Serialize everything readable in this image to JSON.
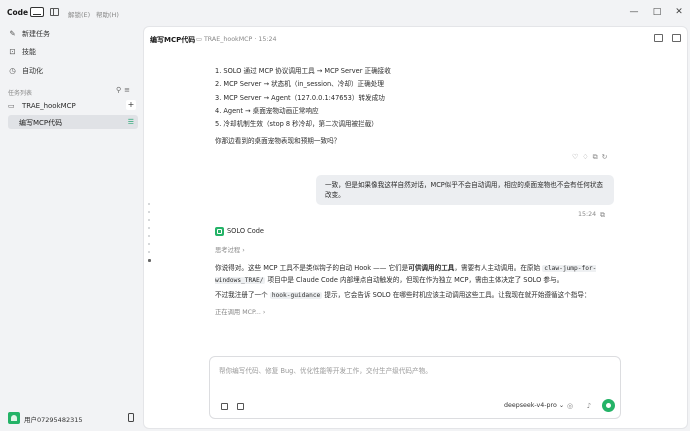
{
  "titlebar": {
    "mode": "Code",
    "menus": [
      "解锁(E)",
      "帮助(H)"
    ],
    "controls": [
      "—",
      "□",
      "✕"
    ]
  },
  "sidebar": {
    "nav": [
      {
        "label": "新建任务",
        "icon": "edit-icon"
      },
      {
        "label": "技能",
        "icon": "skills-icon"
      },
      {
        "label": "自动化",
        "icon": "clock-icon"
      }
    ],
    "section_label": "任务列表",
    "project": "TRAE_hookMCP",
    "task": "编写MCP代码",
    "user": "用户07295482315"
  },
  "header": {
    "title": "编写MCP代码",
    "path": "TRAE_hookMCP · 15:24"
  },
  "chat": {
    "steps": [
      "1. SOLO 通过 MCP 协议调用工具 → MCP Server 正确接收",
      "2. MCP Server → 状态机（in_session、冷却）正确处理",
      "3. MCP Server → Agent（127.0.0.1:47653）转发成功",
      "4. Agent → 桌面宠物动画正常响应",
      "5. 冷却机制生效（stop 8 秒冷却，第二次调用被拦截）"
    ],
    "ask": "你那边看到的桌面宠物表现和预期一致吗？",
    "user_msg": "一致，但是如果像我这样自然对话，MCP似乎不会自动调用，相应的桌面宠物也不会有任何状态改变。",
    "time": "15:24",
    "bot_name": "SOLO Code",
    "think": "思考过程",
    "resp_a": "你说得对。这些 MCP 工具不是类似钩子的自动 Hook —— 它们是",
    "resp_bold": "可供调用的工具",
    "resp_b": "，需要有人主动调用。在原始",
    "resp_code1": "claw-jump-for-windows_TRAE/",
    "resp_c": "项目中是 Claude Code 内部埋点自动触发的，但现在作为独立 MCP，需由主体决定了 SOLO 参与。",
    "resp2_a": "不过我注册了一个",
    "resp2_code": "hook-guidance",
    "resp2_b": "提示，它会告诉 SOLO 在哪些时机应该主动调用这些工具。让我现在就开始遵循这个指导：",
    "calling": "正在调用 MCP..."
  },
  "composer": {
    "placeholder": "帮你编写代码、修复 Bug、优化性能等开发工作，交付生产级代码产物。",
    "model": "deepseek-v4-pro"
  },
  "colors": {
    "accent": "#24b367",
    "bg": "#f2f3f5",
    "panel": "#ffffff"
  }
}
